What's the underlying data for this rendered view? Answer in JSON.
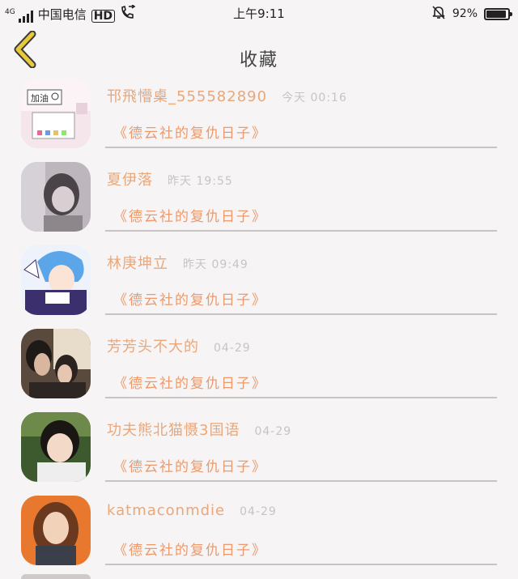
{
  "status_bar": {
    "network": "4G",
    "carrier": "中国电信",
    "hd": "HD",
    "time": "上午9:11",
    "battery_text": "92%",
    "battery_level": 0.92,
    "icons": [
      "signal-icon",
      "hd-call-icon",
      "call-forward-icon",
      "mute-bell-icon",
      "battery-icon"
    ]
  },
  "header": {
    "title": "收藏",
    "back_icon": "chevron-left-icon",
    "accent": "#e8c93a"
  },
  "colors": {
    "name": "#e9a77a",
    "subtitle": "#ec9a6b",
    "time": "#c9c3c3"
  },
  "favorites": [
    {
      "name": "邗飛懵㮚_555582890",
      "time": "今天 00:16",
      "subtitle": "《德云社的复仇日子》",
      "avatar_text": "加油"
    },
    {
      "name": "夏伊落",
      "time": "昨天 19:55",
      "subtitle": "《德云社的复仇日子》"
    },
    {
      "name": "林庚坤立",
      "time": "昨天 09:49",
      "subtitle": "《德云社的复仇日子》"
    },
    {
      "name": "芳芳头不大的",
      "time": "04-29",
      "subtitle": "《德云社的复仇日子》"
    },
    {
      "name": "功夫熊北猫慑3国语",
      "time": "04-29",
      "subtitle": "《德云社的复仇日子》"
    },
    {
      "name": "katmaconmdie",
      "time": "04-29",
      "subtitle": "《德云社的复仇日子》"
    }
  ]
}
